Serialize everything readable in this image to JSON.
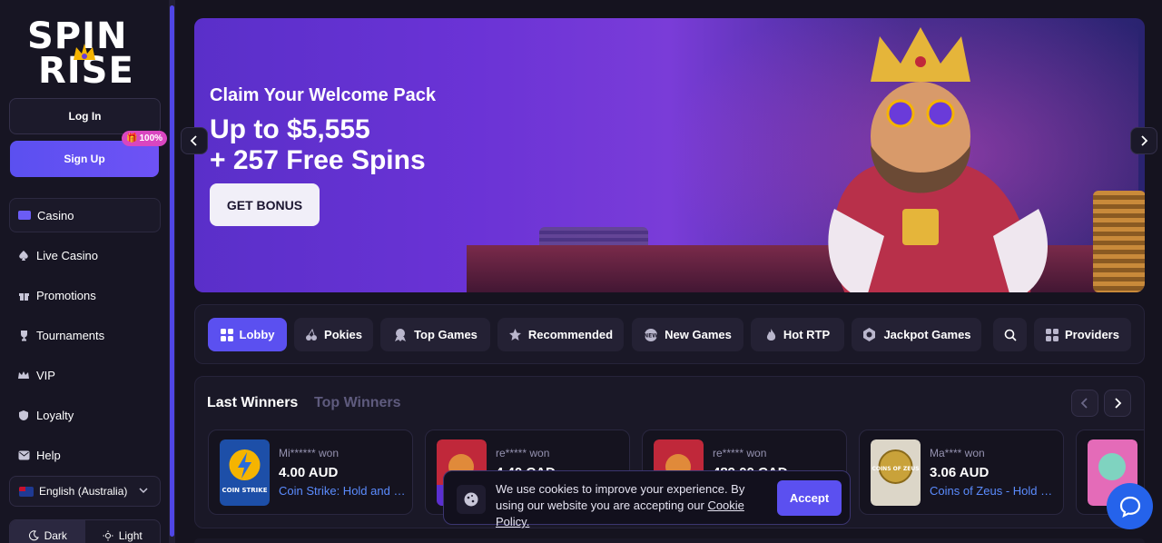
{
  "brand": {
    "line1": "SPIN",
    "line2": "RISE"
  },
  "auth": {
    "login_label": "Log In",
    "signup_label": "Sign Up",
    "signup_badge": "100%"
  },
  "nav": {
    "items": [
      {
        "label": "Casino",
        "icon": "casino-icon"
      },
      {
        "label": "Live Casino",
        "icon": "spade-icon"
      },
      {
        "label": "Promotions",
        "icon": "gift-icon"
      },
      {
        "label": "Tournaments",
        "icon": "trophy-icon"
      },
      {
        "label": "VIP",
        "icon": "crown-icon"
      },
      {
        "label": "Loyalty",
        "icon": "shield-icon"
      },
      {
        "label": "Help",
        "icon": "mail-icon"
      }
    ]
  },
  "language": {
    "selected": "English (Australia)"
  },
  "theme": {
    "dark_label": "Dark",
    "light_label": "Light"
  },
  "banner": {
    "pretitle": "Claim Your Welcome Pack",
    "title_line1": "Up to $5,555",
    "title_line2": "+ 257 Free Spins",
    "cta": "GET BONUS"
  },
  "categories": [
    {
      "label": "Lobby",
      "icon": "grid-icon"
    },
    {
      "label": "Pokies",
      "icon": "cherries-icon"
    },
    {
      "label": "Top Games",
      "icon": "medal-icon"
    },
    {
      "label": "Recommended",
      "icon": "star-icon"
    },
    {
      "label": "New Games",
      "icon": "new-icon"
    },
    {
      "label": "Hot RTP",
      "icon": "flame-icon"
    },
    {
      "label": "Jackpot Games",
      "icon": "jackpot-icon"
    },
    {
      "label": "",
      "icon": "search-icon"
    },
    {
      "label": "Providers",
      "icon": "grid-icon"
    }
  ],
  "winners": {
    "tab_last": "Last Winners",
    "tab_top": "Top Winners",
    "cards": [
      {
        "user": "Mi****** won",
        "amount": "4.00 AUD",
        "game": "Coin Strike: Hold and Win",
        "thumb_label": "COIN STRIKE"
      },
      {
        "user": "re***** won",
        "amount": "4.40 CAD",
        "game": "",
        "thumb_label": ""
      },
      {
        "user": "re***** won",
        "amount": "489.00 CAD",
        "game": "",
        "thumb_label": ""
      },
      {
        "user": "Ma**** won",
        "amount": "3.06 AUD",
        "game": "Coins of Zeus - Hold and Win",
        "thumb_label": "COINS OF ZEUS"
      }
    ]
  },
  "cookie": {
    "text": "We use cookies to improve your experience. By using our website you are accepting our",
    "link": "Cookie Policy.",
    "accept": "Accept"
  }
}
